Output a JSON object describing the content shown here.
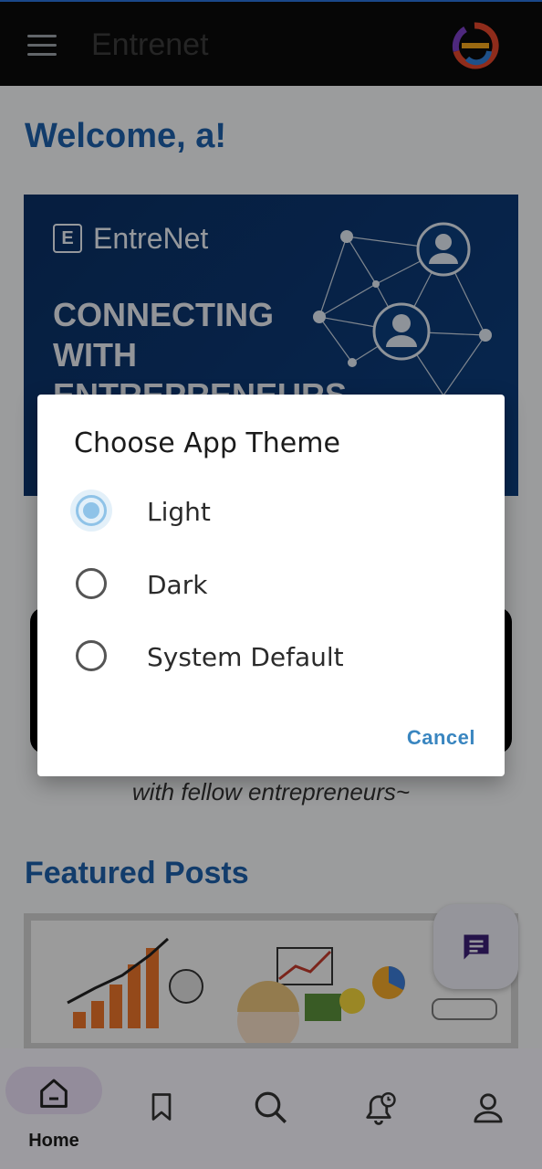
{
  "topbar": {
    "title": "Entrenet",
    "menu_icon": "hamburger-icon",
    "logo_icon": "entrenet-logo-icon"
  },
  "welcome": "Welcome, a!",
  "banner": {
    "brand_letter": "E",
    "brand_name": "EntreNet",
    "tagline": "CONNECTING WITH ENTREPRENEURS"
  },
  "subtext": "with fellow entrepreneurs~",
  "featured_title": "Featured Posts",
  "fab_icon": "chat-icon",
  "bottom_nav": {
    "items": [
      {
        "label": "Home",
        "icon": "home-icon",
        "active": true
      },
      {
        "label": "",
        "icon": "bookmark-icon",
        "active": false
      },
      {
        "label": "",
        "icon": "search-icon",
        "active": false
      },
      {
        "label": "",
        "icon": "bell-clock-icon",
        "active": false
      },
      {
        "label": "",
        "icon": "profile-icon",
        "active": false
      }
    ]
  },
  "dialog": {
    "title": "Choose App Theme",
    "options": [
      {
        "label": "Light",
        "selected": true
      },
      {
        "label": "Dark",
        "selected": false
      },
      {
        "label": "System Default",
        "selected": false
      }
    ],
    "cancel_label": "Cancel"
  },
  "colors": {
    "accent": "#1d5fa8",
    "dialog_accent": "#8fc3e8",
    "cancel": "#3a86c0",
    "banner_bg": "#0b3570"
  }
}
